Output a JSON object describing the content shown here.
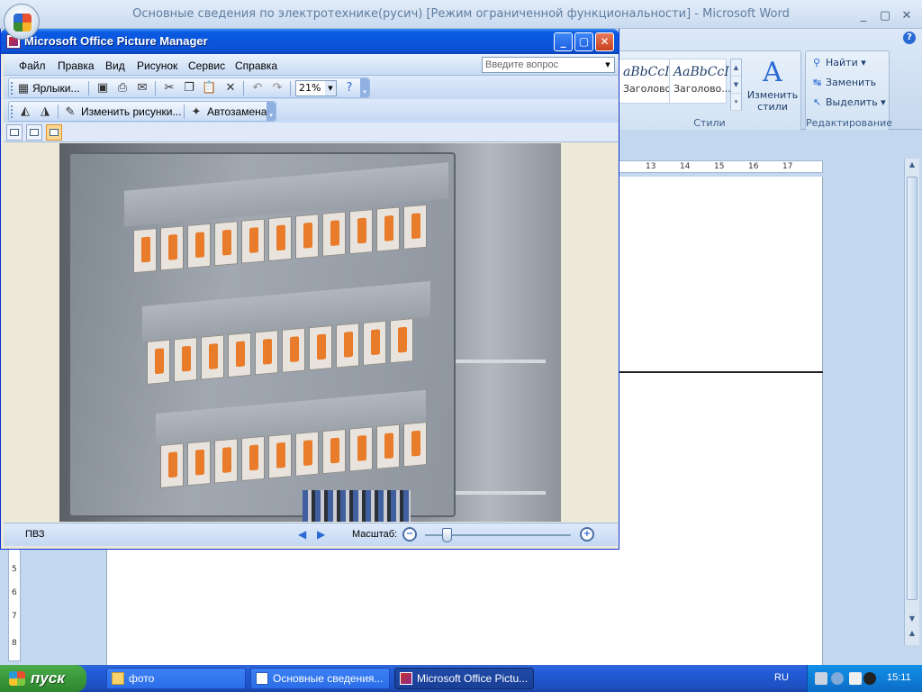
{
  "word": {
    "title": "Основные сведения по электротехнике(русич) [Режим ограниченной функциональности] - Microsoft Word",
    "window_controls": [
      "_",
      "▢",
      "✕"
    ],
    "styles_group": {
      "tiles": [
        {
          "sample": "aBbCcI",
          "name": "Заголово..."
        },
        {
          "sample": "AaBbCcI",
          "name": "Заголово..."
        }
      ],
      "change_styles_label": "Изменить стили",
      "change_styles_glyph": "A",
      "label": "Стили"
    },
    "editing_group": {
      "find": "Найти",
      "replace": "Заменить",
      "select": "Выделить",
      "label": "Редактирование"
    },
    "ruler_h": [
      "13",
      "14",
      "15",
      "16",
      "17"
    ],
    "ruler_v": [
      "5",
      "6",
      "7",
      "8"
    ]
  },
  "picture_manager": {
    "title": "Microsoft Office Picture Manager",
    "menu": [
      "Файл",
      "Правка",
      "Вид",
      "Рисунок",
      "Сервис",
      "Справка"
    ],
    "ask_placeholder": "Введите вопрос",
    "toolbar": {
      "shortcuts": "Ярлыки...",
      "zoom_value": "21%",
      "edit_pictures": "Изменить рисунки...",
      "auto_correct": "Автозамена"
    },
    "status": {
      "file_name": "ПВЗ",
      "zoom_label": "Масштаб:",
      "zoom_level": 0.15
    }
  },
  "taskbar": {
    "start": "пуск",
    "tasks": [
      {
        "label": "фото"
      },
      {
        "label": "Основные сведения..."
      },
      {
        "label": "Microsoft Office Pictu..."
      }
    ],
    "language": "RU",
    "clock": "15:11"
  },
  "colors": {
    "xp_blue": "#0c52d4",
    "office_ribbon": "#c5d8ee",
    "breaker_handle": "#e87c2a"
  }
}
